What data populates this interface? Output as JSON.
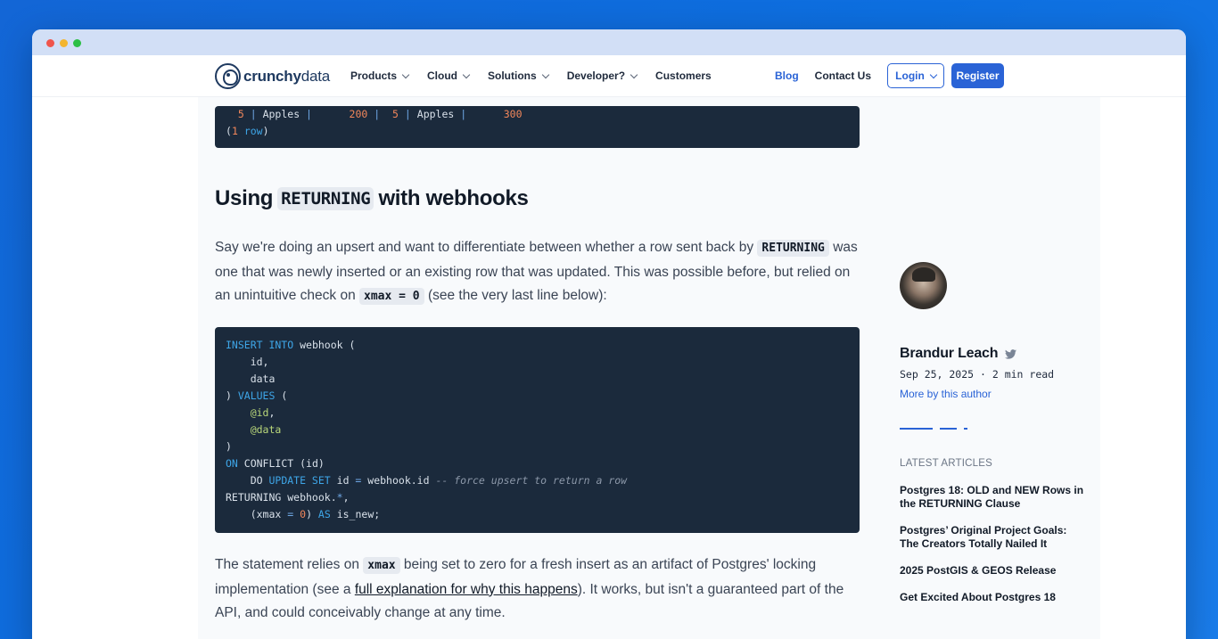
{
  "nav": {
    "logo_bold": "crunchy",
    "logo_light": "data",
    "items": [
      {
        "label": "Products",
        "has_menu": true
      },
      {
        "label": "Cloud",
        "has_menu": true
      },
      {
        "label": "Solutions",
        "has_menu": true
      },
      {
        "label": "Developer?",
        "has_menu": true
      },
      {
        "label": "Customers",
        "has_menu": false
      }
    ],
    "blog": "Blog",
    "contact": "Contact Us",
    "login": "Login",
    "register": "Register"
  },
  "code_top": {
    "lines": [
      "  5 | Apples |      200 |  5 | Apples |      300",
      "(1 row)"
    ]
  },
  "heading": {
    "before": "Using",
    "code": "RETURNING",
    "after": "with webhooks"
  },
  "para1": {
    "t1": "Say we're doing an upsert and want to differentiate between whether a row sent back by",
    "code1": "RETURNING",
    "t2": "was one that was newly inserted or an existing row that was updated. This was possible before, but relied on an unintuitive check on",
    "code2": "xmax = 0",
    "t3": "(see the very last line below):"
  },
  "code_main": {
    "lines": [
      "INSERT INTO webhook (",
      "    id,",
      "    data",
      ") VALUES (",
      "    @id,",
      "    @data",
      ")",
      "ON CONFLICT (id)",
      "    DO UPDATE SET id = webhook.id -- force upsert to return a row",
      "RETURNING webhook.*,",
      "    (xmax = 0) AS is_new;"
    ]
  },
  "para2": {
    "t1": "The statement relies on",
    "code1": "xmax",
    "t2": "being set to zero for a fresh insert as an artifact of Postgres' locking implementation (see a",
    "link": "full explanation for why this happens",
    "t3": "). It works, but isn't a guaranteed part of the API, and could conceivably change at any time."
  },
  "author": {
    "name": "Brandur Leach",
    "meta": "Sep 25, 2025 · 2 min read",
    "more": "More by this author"
  },
  "reading_progress": [
    0.37,
    0.19,
    0.04
  ],
  "latest": {
    "label": "LATEST ARTICLES",
    "articles": [
      "Postgres 18: OLD and NEW Rows in the RETURNING Clause",
      "Postgres’ Original Project Goals: The Creators Totally Nailed It",
      "2025 PostGIS & GEOS Release",
      "Get Excited About Postgres 18"
    ]
  },
  "colors": {
    "accent": "#2a63d6",
    "code_bg": "#1b2a3c",
    "background": "#0d6fe0"
  }
}
